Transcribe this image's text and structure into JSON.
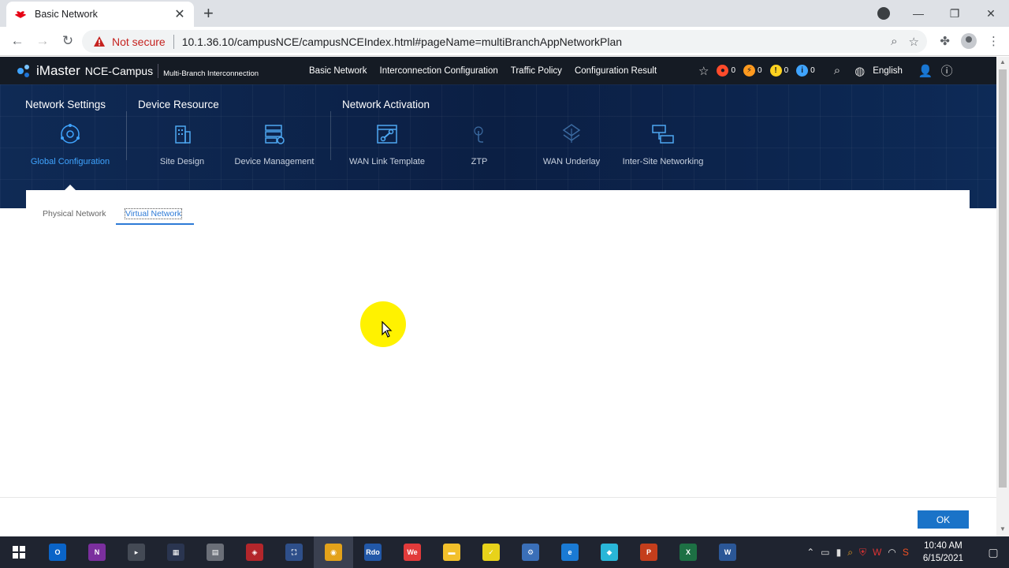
{
  "browser": {
    "tab_title": "Basic Network",
    "tab_close": "✕",
    "new_tab": "+",
    "not_secure": "Not secure",
    "url": "10.1.36.10/campusNCE/campusNCEIndex.html#pageName=multiBranchAppNetworkPlan"
  },
  "app": {
    "brand": "iMaster",
    "product": "NCE-Campus",
    "subtitle": "Multi-Branch Interconnection",
    "nav": [
      "Basic Network",
      "Interconnection Configuration",
      "Traffic Policy",
      "Configuration Result"
    ],
    "alarms": [
      {
        "count": "0",
        "color": "#ff4b2b",
        "glyph": "●"
      },
      {
        "count": "0",
        "color": "#ff9a1f",
        "glyph": "⚡"
      },
      {
        "count": "0",
        "color": "#ffd21f",
        "glyph": "!"
      },
      {
        "count": "0",
        "color": "#3fa4ff",
        "glyph": "i"
      }
    ],
    "language": "English"
  },
  "banner": {
    "groups": [
      "Network Settings",
      "Device Resource",
      "Network Activation"
    ],
    "modules": [
      "Global Configuration",
      "Site Design",
      "Device Management",
      "WAN Link Template",
      "ZTP",
      "WAN Underlay",
      "Inter-Site Networking"
    ]
  },
  "panel": {
    "tabs": [
      "Physical Network",
      "Virtual Network"
    ],
    "ok_label": "OK"
  },
  "taskbar": {
    "time": "10:40 AM",
    "date": "6/15/2021",
    "apps": [
      {
        "name": "outlook",
        "label": "O",
        "color": "#0a64c8"
      },
      {
        "name": "onenote",
        "label": "N",
        "color": "#7b2f9e"
      },
      {
        "name": "tool",
        "label": "▸",
        "color": "#444a55"
      },
      {
        "name": "network",
        "label": "▦",
        "color": "#2a3550"
      },
      {
        "name": "calculator",
        "label": "▤",
        "color": "#6b6f78"
      },
      {
        "name": "security",
        "label": "◈",
        "color": "#b3262b"
      },
      {
        "name": "connections",
        "label": "⛶",
        "color": "#2e4f8a"
      },
      {
        "name": "chrome",
        "label": "◉",
        "color": "#e3a21a"
      },
      {
        "name": "rdo",
        "label": "Rdo",
        "color": "#2258a8"
      },
      {
        "name": "welink",
        "label": "We",
        "color": "#e23b3b"
      },
      {
        "name": "explorer",
        "label": "▬",
        "color": "#f2c02b"
      },
      {
        "name": "notes",
        "label": "✓",
        "color": "#e8d21a"
      },
      {
        "name": "devtool",
        "label": "⚙",
        "color": "#3a6fb8"
      },
      {
        "name": "edge",
        "label": "e",
        "color": "#1a7ad4"
      },
      {
        "name": "meeting",
        "label": "◆",
        "color": "#29b6d8"
      },
      {
        "name": "powerpoint",
        "label": "P",
        "color": "#c43e1c"
      },
      {
        "name": "excel",
        "label": "X",
        "color": "#1d7044"
      },
      {
        "name": "word",
        "label": "W",
        "color": "#2b5797"
      }
    ]
  }
}
